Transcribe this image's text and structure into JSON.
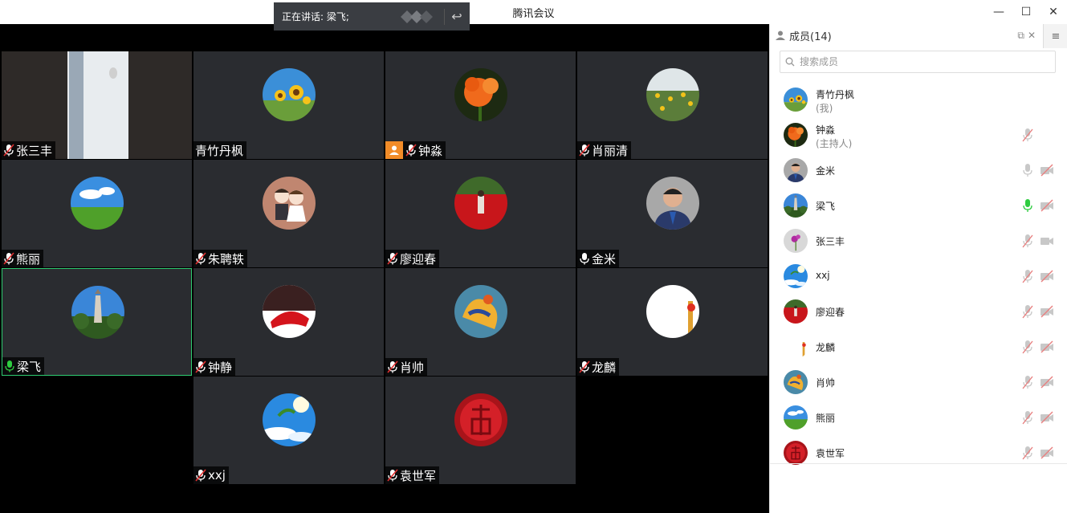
{
  "window": {
    "title": "腾讯会议",
    "minimize": "—",
    "maximize": "☐",
    "close": "✕"
  },
  "speaking": {
    "label": "正在讲话: 梁飞;"
  },
  "tiles": [
    {
      "name": "张三丰",
      "mic": "muted",
      "avatar": "room-photo"
    },
    {
      "name": "青竹丹枫",
      "mic": "none",
      "avatar": "sunflower"
    },
    {
      "name": "钟淼",
      "mic": "muted",
      "host": true,
      "avatar": "orange-flower"
    },
    {
      "name": "肖丽清",
      "mic": "muted",
      "avatar": "sunflower-field"
    },
    {
      "name": "熊丽",
      "mic": "muted",
      "avatar": "grassland"
    },
    {
      "name": "朱聘轶",
      "mic": "muted",
      "avatar": "couple-cartoon"
    },
    {
      "name": "廖迎春",
      "mic": "muted",
      "avatar": "red-flowers"
    },
    {
      "name": "金米",
      "mic": "on",
      "avatar": "man-portrait"
    },
    {
      "name": "梁飞",
      "mic": "speaking",
      "active": true,
      "avatar": "pagoda"
    },
    {
      "name": "钟静",
      "mic": "muted",
      "avatar": "red-dress"
    },
    {
      "name": "肖帅",
      "mic": "muted",
      "avatar": "painting"
    },
    {
      "name": "龙麟",
      "mic": "muted",
      "avatar": "white-flag"
    },
    {
      "name": "xxj",
      "mic": "muted",
      "avatar": "sky"
    },
    {
      "name": "袁世军",
      "mic": "muted",
      "avatar": "fu-character"
    }
  ],
  "panel": {
    "title": "成员(14)",
    "search_placeholder": "搜索成员",
    "members": [
      {
        "name": "青竹丹枫",
        "sub": "(我)",
        "mic": "",
        "cam": "",
        "avatar": "sunflower"
      },
      {
        "name": "钟淼",
        "sub": "(主持人)",
        "mic": "muted",
        "cam": "",
        "avatar": "orange-flower"
      },
      {
        "name": "金米",
        "sub": "",
        "mic": "on",
        "cam": "off",
        "avatar": "man-portrait"
      },
      {
        "name": "梁飞",
        "sub": "",
        "mic": "speaking",
        "cam": "off",
        "avatar": "pagoda"
      },
      {
        "name": "张三丰",
        "sub": "",
        "mic": "muted",
        "cam": "on",
        "avatar": "purple-flower"
      },
      {
        "name": "xxj",
        "sub": "",
        "mic": "muted",
        "cam": "off",
        "avatar": "sky"
      },
      {
        "name": "廖迎春",
        "sub": "",
        "mic": "muted",
        "cam": "off",
        "avatar": "red-flowers"
      },
      {
        "name": "龙麟",
        "sub": "",
        "mic": "muted",
        "cam": "off",
        "avatar": "white-flag"
      },
      {
        "name": "肖帅",
        "sub": "",
        "mic": "muted",
        "cam": "off",
        "avatar": "painting"
      },
      {
        "name": "熊丽",
        "sub": "",
        "mic": "muted",
        "cam": "off",
        "avatar": "grassland"
      },
      {
        "name": "袁世军",
        "sub": "",
        "mic": "muted",
        "cam": "off",
        "avatar": "fu-character"
      }
    ]
  }
}
